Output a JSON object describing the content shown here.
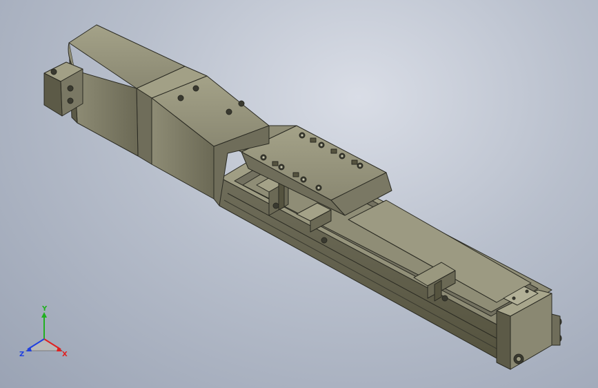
{
  "viewport": {
    "background_top": "#d9dde6",
    "background_bottom": "#9aa3b4"
  },
  "model": {
    "body_color": "#7d7b67",
    "body_light": "#9a987f",
    "body_dark": "#55533f",
    "edge_color": "#2a2a22"
  },
  "triad": {
    "x_label": "X",
    "y_label": "Y",
    "z_label": "Z",
    "x_color": "#e02020",
    "y_color": "#20b020",
    "z_color": "#2040e0"
  }
}
